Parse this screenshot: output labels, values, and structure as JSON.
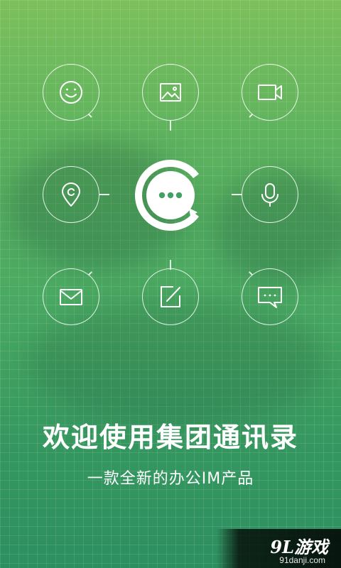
{
  "colors": {
    "background_top": "#7cc05c",
    "background_bottom": "#2d8f60",
    "icon_stroke": "#ffffff",
    "logo_fill": "#ffffff",
    "logo_dots": "#42a265"
  },
  "features": [
    {
      "icon": "smiley-face-icon"
    },
    {
      "icon": "image-icon"
    },
    {
      "icon": "video-camera-icon"
    },
    {
      "icon": "location-pin-icon"
    },
    {
      "icon": "microphone-icon"
    },
    {
      "icon": "mail-envelope-icon"
    },
    {
      "icon": "edit-note-icon"
    },
    {
      "icon": "chat-bubble-icon"
    }
  ],
  "logo": {
    "icon": "chat-bubble-logo-icon"
  },
  "headline": {
    "title": "欢迎使用集团通讯录",
    "subtitle": "一款全新的办公IM产品"
  },
  "watermark": {
    "brand": "9L游戏",
    "url": "91danji.com"
  }
}
